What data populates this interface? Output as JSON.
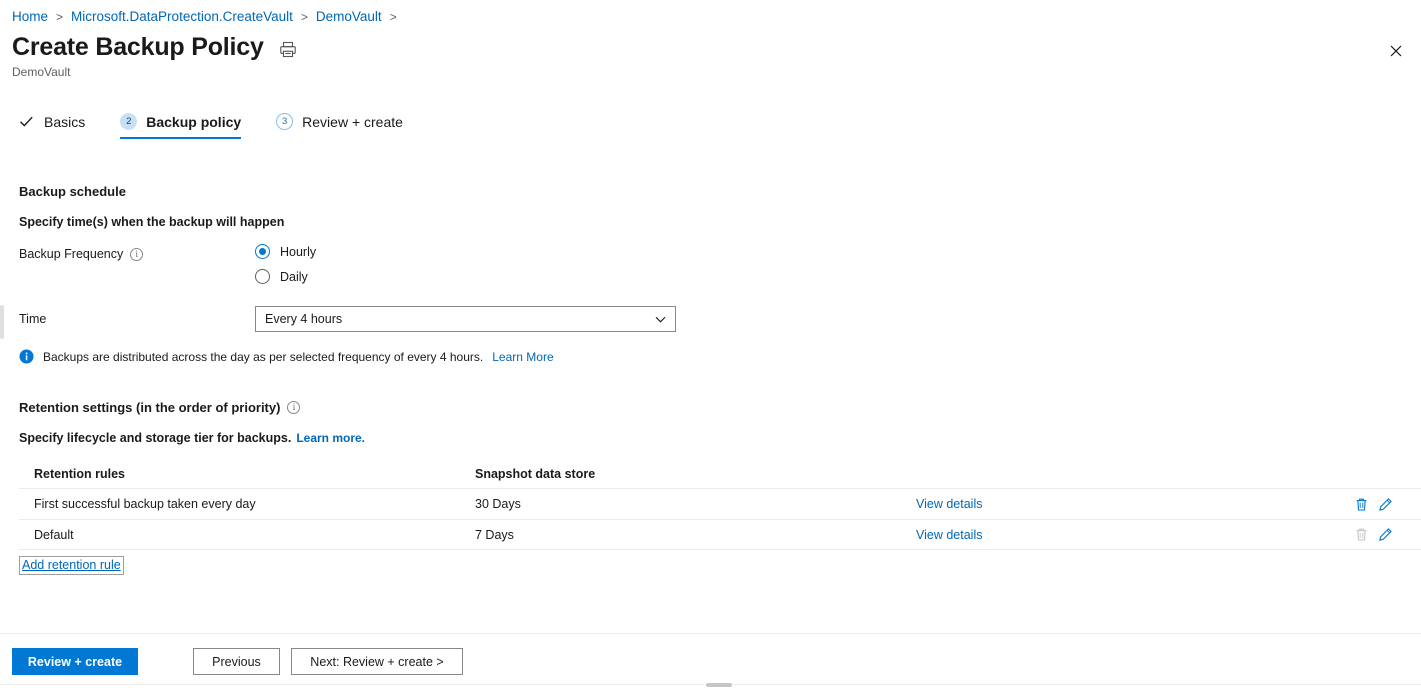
{
  "breadcrumb": [
    {
      "label": "Home"
    },
    {
      "label": "Microsoft.DataProtection.CreateVault"
    },
    {
      "label": "DemoVault"
    }
  ],
  "breadcrumb_separator": ">",
  "header": {
    "title": "Create Backup Policy",
    "subtitle": "DemoVault",
    "print_icon": "printer-icon",
    "close_icon": "close-icon"
  },
  "steps": [
    {
      "marker": "✓",
      "marker_type": "check",
      "label": "Basics",
      "active": false
    },
    {
      "marker": "2",
      "marker_type": "number-filled",
      "label": "Backup policy",
      "active": true
    },
    {
      "marker": "3",
      "marker_type": "number-outline",
      "label": "Review + create",
      "active": false
    }
  ],
  "schedule": {
    "section_title": "Backup schedule",
    "instruction": "Specify time(s) when the backup will happen",
    "frequency_label": "Backup Frequency",
    "frequency_info_icon": "info-icon",
    "frequency_options": [
      {
        "label": "Hourly",
        "selected": true
      },
      {
        "label": "Daily",
        "selected": false
      }
    ],
    "time_label": "Time",
    "time_value": "Every 4 hours",
    "time_chevron_icon": "chevron-down-icon",
    "info_icon": "info-filled-icon",
    "info_text": "Backups are distributed across the day as per selected frequency of every 4 hours.",
    "info_link": "Learn More"
  },
  "retention": {
    "section_title": "Retention settings (in the order of priority)",
    "section_info_icon": "info-icon",
    "instruction": "Specify lifecycle and storage tier for backups.",
    "instruction_link": "Learn more.",
    "columns": [
      "Retention rules",
      "Snapshot data store"
    ],
    "rows": [
      {
        "rule": "First successful backup taken every day",
        "store": "30 Days",
        "view_link": "View details",
        "delete_icon": "trash-icon",
        "delete_enabled": true,
        "edit_icon": "pencil-icon",
        "edit_enabled": true
      },
      {
        "rule": "Default",
        "store": "7 Days",
        "view_link": "View details",
        "delete_icon": "trash-icon",
        "delete_enabled": false,
        "edit_icon": "pencil-icon",
        "edit_enabled": true
      }
    ],
    "add_link": "Add retention rule"
  },
  "footer": {
    "primary": "Review + create",
    "previous": "Previous",
    "next": "Next: Review + create >"
  },
  "colors": {
    "accent": "#0078d4",
    "link": "#0067b8",
    "text": "#1b1a19",
    "muted": "#605e5c",
    "border": "#8a8886",
    "divider": "#edebe9",
    "step_fill": "#c7e0f4",
    "disabled_icon": "#c8c6c4"
  }
}
